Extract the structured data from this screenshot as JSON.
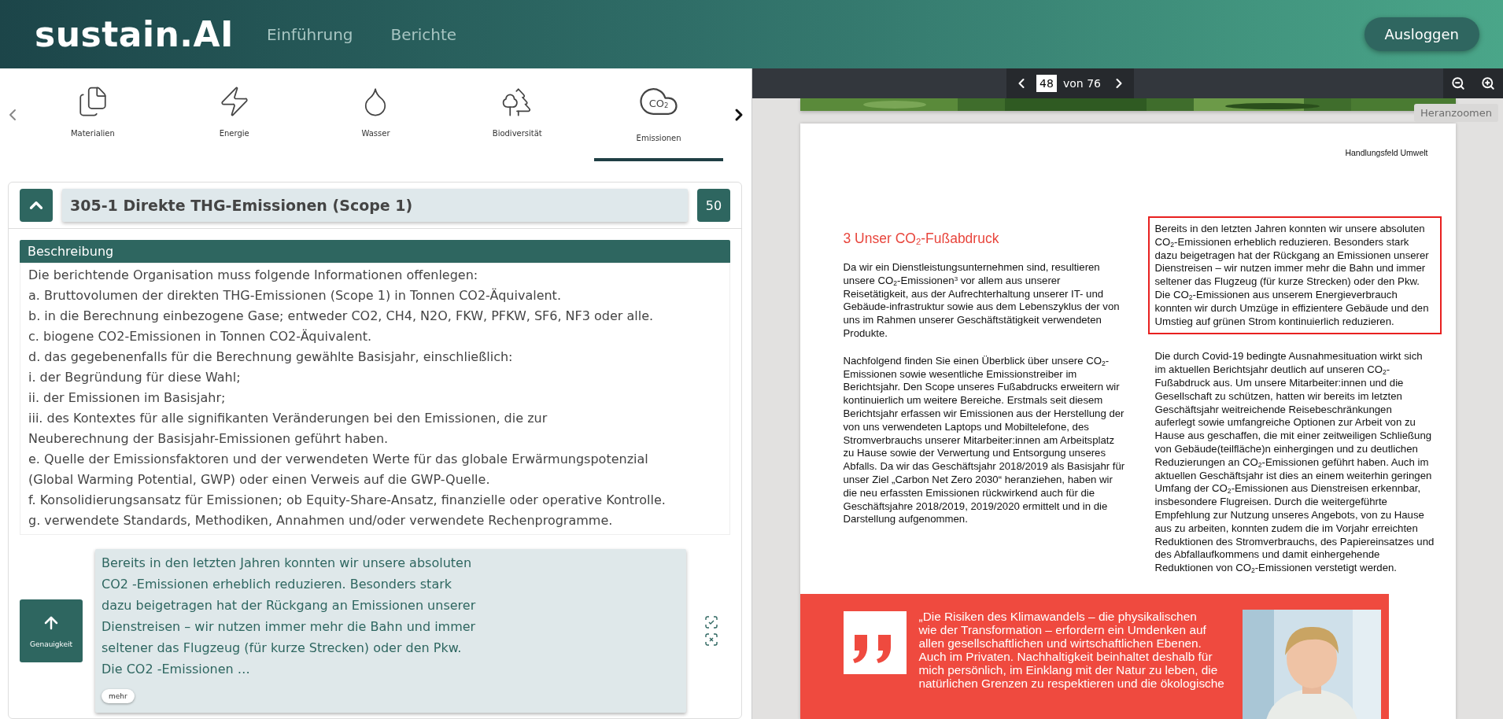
{
  "header": {
    "logo": "sustain.AI",
    "nav": [
      {
        "label": "Einführung",
        "selected": false
      },
      {
        "label": "Berichte",
        "selected": false
      }
    ],
    "logout": "Ausloggen"
  },
  "categories": [
    {
      "kind": "files",
      "label": "Materialien",
      "selected": false
    },
    {
      "kind": "bolt",
      "label": "Energie",
      "selected": false
    },
    {
      "kind": "drop",
      "label": "Wasser",
      "selected": false
    },
    {
      "kind": "trees",
      "label": "Biodiversität",
      "selected": false
    },
    {
      "kind": "cloud",
      "label": "Emissionen",
      "icon_text": "CO$_{2}$",
      "selected": true
    }
  ],
  "disclosure": {
    "expanded": true,
    "title": "305-1 Direkte THG-Emissionen (Scope 1)",
    "count": "50",
    "section_title": "Beschreibung",
    "lines": [
      "Die berichtende Organisation muss folgende Informationen offenlegen:",
      "a. Bruttovolumen der direkten THG-Emissionen (Scope 1) in Tonnen CO2-Äquivalent.",
      "b. in die Berechnung einbezogene Gase; entweder CO2, CH4, N2O, FKW, PFKW, SF6, NF3 oder alle.",
      "c. biogene CO2-Emissionen in Tonnen CO2-Äquivalent.",
      "d. das gegebenenfalls für die Berechnung gewählte Basisjahr, einschließlich:",
      "i. der Begründung für diese Wahl;",
      "ii. der Emissionen im Basisjahr;",
      "iii. des Kontextes für alle signifikanten Veränderungen bei den Emissionen, die zur",
      "Neuberechnung der Basisjahr-Emissionen geführt haben.",
      "e. Quelle der Emissionsfaktoren und der verwendeten Werte für das globale Erwärmungspotenzial",
      "(Global Warming Potential, GWP) oder einen Verweis auf die GWP-Quelle.",
      "f. Konsolidierungsansatz für Emissionen; ob Equity-Share-Ansatz, finanzielle oder operative Kontrolle.",
      "g. verwendete Standards, Methodiken, Annahmen und/oder verwendete Rechenprogramme."
    ]
  },
  "result": {
    "sort_label": "Genauigkeit",
    "lines": [
      "Bereits in den letzten Jahren konnten wir unsere absoluten",
      "CO2 -Emissionen erheblich reduzieren. Besonders stark",
      "dazu beigetragen hat der Rückgang an Emissionen unserer",
      "Dienstreisen – wir nutzen immer mehr die Bahn und immer",
      "seltener das Flugzeug (für kurze Strecken) oder den Pkw.",
      "Die CO2 -Emissionen …"
    ],
    "more": "mehr"
  },
  "viewer": {
    "page": "48",
    "of": "von 76",
    "tooltip": "Heranzoomen",
    "running_head": "Handlungsfeld Umwelt",
    "heading": "3  Unser CO$_{2}$-Fußabdruck",
    "left_paragraphs": [
      "Da wir ein Dienstleistungsunternehmen sind, resultieren unsere CO$_{2}$-Emissionen$^{3}$ vor allem aus unserer Reisetätigkeit, aus der Aufrechterhaltung unserer IT- und Gebäude-infrastruktur sowie aus dem Lebenszyklus der von uns im Rahmen unserer Geschäftstätigkeit verwendeten Produkte.",
      "Nachfolgend finden Sie einen Überblick über unsere CO$_{2}$-Emissionen sowie wesentliche Emissionstreiber im Berichtsjahr. Den Scope unseres Fußabdrucks erweitern wir kontinuierlich um weitere Bereiche. Erstmals seit diesem Berichtsjahr erfassen wir Emissionen aus der Herstellung der von uns verwendeten Laptops und Mobiltelefone, des Stromverbrauchs unserer Mitarbeiter:innen am Arbeitsplatz zu Hause sowie der Verwertung und Entsorgung unseres Abfalls. Da wir das Geschäftsjahr 2018/2019 als Basisjahr für unser Ziel „Carbon Net Zero 2030“ heranziehen, haben wir die neu erfassten Emissionen rückwirkend auch für die Geschäftsjahre 2018/2019, 2019/2020 ermittelt und in die Darstellung aufgenommen."
    ],
    "right_paragraphs": [
      {
        "highlighted": true,
        "text": "Bereits in den letzten Jahren konnten wir unsere absoluten CO$_{2}$-Emissionen erheblich reduzieren. Besonders stark dazu beigetragen hat der Rückgang an Emissionen unserer Dienstreisen – wir nutzen immer mehr die Bahn und immer seltener das Flugzeug (für kurze Strecken) oder den Pkw. Die CO$_{2}$-Emissionen aus unserem Energieverbrauch konnten wir durch Umzüge in effizientere Gebäude und den Umstieg auf grünen Strom kontinuierlich reduzieren."
      },
      {
        "highlighted": false,
        "text": "Die durch Covid-19 bedingte Ausnahmesituation wirkt sich im aktuellen Berichtsjahr deutlich auf unseren CO$_{2}$-Fußabdruck aus. Um unsere Mitarbeiter:innen und die Gesellschaft zu schützen, hatten wir bereits im letzten Geschäftsjahr weitreichende Reisebeschränkungen auferlegt sowie umfangreiche Optionen zur Arbeit von zu Hause aus geschaffen, die mit einer zeitweiligen Schließung von Gebäude(teilfläche)n einhergingen und zu deutlichen Reduzierungen an CO$_{2}$-Emissionen geführt haben. Auch im aktuellen Geschäftsjahr ist dies an einem weiterhin geringen Umfang der CO$_{2}$-Emissionen aus Dienstreisen erkennbar, insbesondere Flugreisen. Durch die weitergeführte Empfehlung zur Nutzung unseres Angebots, von zu Hause aus zu arbeiten, konnten zudem die im Vorjahr erreichten Reduktionen des Stromverbrauchs, des Papiereinsatzes und des Abfallaufkommens und damit einhergehende Reduktionen von CO$_{2}$-Emissionen verstetigt werden."
      }
    ],
    "quote_lines": [
      "„Die Risiken des Klimawandels – die physikalischen",
      "wie der Transformation – erfordern ein Umdenken auf",
      "allen gesellschaftlichen und wirtschaftlichen Ebenen.",
      "Auch im Privaten. Nachhaltigkeit beinhaltet deshalb für",
      "mich persönlich, im Einklang mit der Natur zu leben, die",
      "natürlichen Grenzen zu respektieren und die ökologische"
    ]
  }
}
